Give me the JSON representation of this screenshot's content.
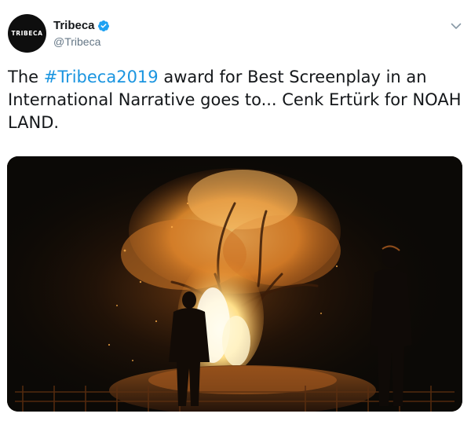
{
  "author": {
    "avatar_text": "TRIBECA",
    "display_name": "Tribeca",
    "handle": "@Tribeca",
    "verified": true
  },
  "tweet": {
    "text_before": "The ",
    "hashtag": "#Tribeca2019",
    "text_after": " award for Best Screenplay in an International Narrative goes to... Cenk Ertürk for NOAH LAND."
  },
  "icons": {
    "verified": "verified-badge-icon",
    "menu": "chevron-down-icon"
  },
  "colors": {
    "link": "#1b95e0",
    "verified": "#1da1f2",
    "handle": "#657786",
    "text": "#14171a"
  }
}
